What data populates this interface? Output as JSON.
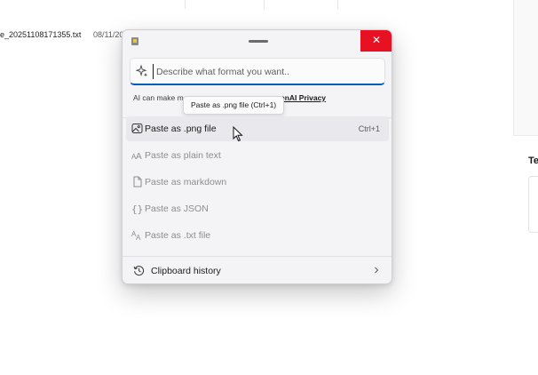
{
  "background": {
    "file_name": "e_20251108171355.txt",
    "file_date": "08/11/20",
    "right_panel_label": "Te"
  },
  "popup": {
    "prompt": {
      "placeholder": "Describe what format you want.."
    },
    "ai_note": "AI can make m",
    "ai_link": "enAI Privacy",
    "tooltip": "Paste as .png file (Ctrl+1)",
    "items": [
      {
        "label": "Paste as .png file",
        "shortcut": "Ctrl+1",
        "icon": "image-icon",
        "enabled": true
      },
      {
        "label": "Paste as plain text",
        "icon": "text-icon",
        "enabled": false
      },
      {
        "label": "Paste as markdown",
        "icon": "document-icon",
        "enabled": false
      },
      {
        "label": "Paste as JSON",
        "icon": "braces-icon",
        "enabled": false
      },
      {
        "label": "Paste as .txt file",
        "icon": "text-file-icon",
        "enabled": false
      }
    ],
    "history": {
      "label": "Clipboard history",
      "icon": "history-icon"
    }
  },
  "colors": {
    "close": "#e81123",
    "accent": "#005fb8",
    "disabled_text": "#8d8d8d"
  }
}
